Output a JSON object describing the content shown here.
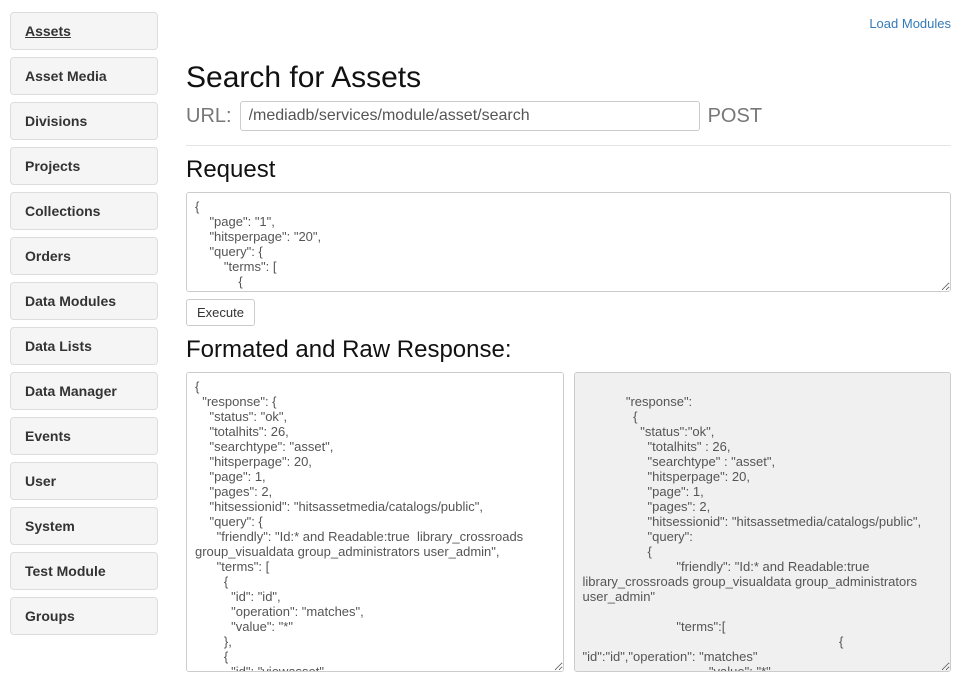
{
  "sidebar": {
    "items": [
      {
        "label": "Assets",
        "active": true
      },
      {
        "label": "Asset Media",
        "active": false
      },
      {
        "label": "Divisions",
        "active": false
      },
      {
        "label": "Projects",
        "active": false
      },
      {
        "label": "Collections",
        "active": false
      },
      {
        "label": "Orders",
        "active": false
      },
      {
        "label": "Data Modules",
        "active": false
      },
      {
        "label": "Data Lists",
        "active": false
      },
      {
        "label": "Data Manager",
        "active": false
      },
      {
        "label": "Events",
        "active": false
      },
      {
        "label": "User",
        "active": false
      },
      {
        "label": "System",
        "active": false
      },
      {
        "label": "Test Module",
        "active": false
      },
      {
        "label": "Groups",
        "active": false
      }
    ]
  },
  "topbar": {
    "load_modules_label": "Load Modules"
  },
  "header": {
    "title": "Search for Assets",
    "url_label": "URL:",
    "url_value": "/mediadb/services/module/asset/search",
    "method": "POST"
  },
  "request": {
    "title": "Request",
    "body": "{\n    \"page\": \"1\",\n    \"hitsperpage\": \"20\",\n    \"query\": {\n        \"terms\": [\n            {",
    "execute_label": "Execute"
  },
  "response": {
    "title": "Formated and Raw Response:",
    "formatted": "{\n  \"response\": {\n    \"status\": \"ok\",\n    \"totalhits\": 26,\n    \"searchtype\": \"asset\",\n    \"hitsperpage\": 20,\n    \"page\": 1,\n    \"pages\": 2,\n    \"hitsessionid\": \"hitsassetmedia/catalogs/public\",\n    \"query\": {\n      \"friendly\": \"Id:* and Readable:true  library_crossroads group_visualdata group_administrators user_admin\",\n      \"terms\": [\n        {\n          \"id\": \"id\",\n          \"operation\": \"matches\",\n          \"value\": \"*\"\n        },\n        {\n          \"id\": \"viewasset\",",
    "raw": "\n            \"response\":\n              {\n                \"status\":\"ok\",\n                  \"totalhits\" : 26,\n                  \"searchtype\" : \"asset\",\n                  \"hitsperpage\": 20,\n                  \"page\": 1,\n                  \"pages\": 2,\n                  \"hitsessionid\": \"hitsassetmedia/catalogs/public\",\n                  \"query\":\n                  {\n                          \"friendly\": \"Id:* and Readable:true  library_crossroads group_visualdata group_administrators user_admin\"\n                  \n                          \"terms\":[\n                                                                       {   \"id\":\"id\",\"operation\": \"matches\"\n                                  ,\"value\": \"*\""
  }
}
